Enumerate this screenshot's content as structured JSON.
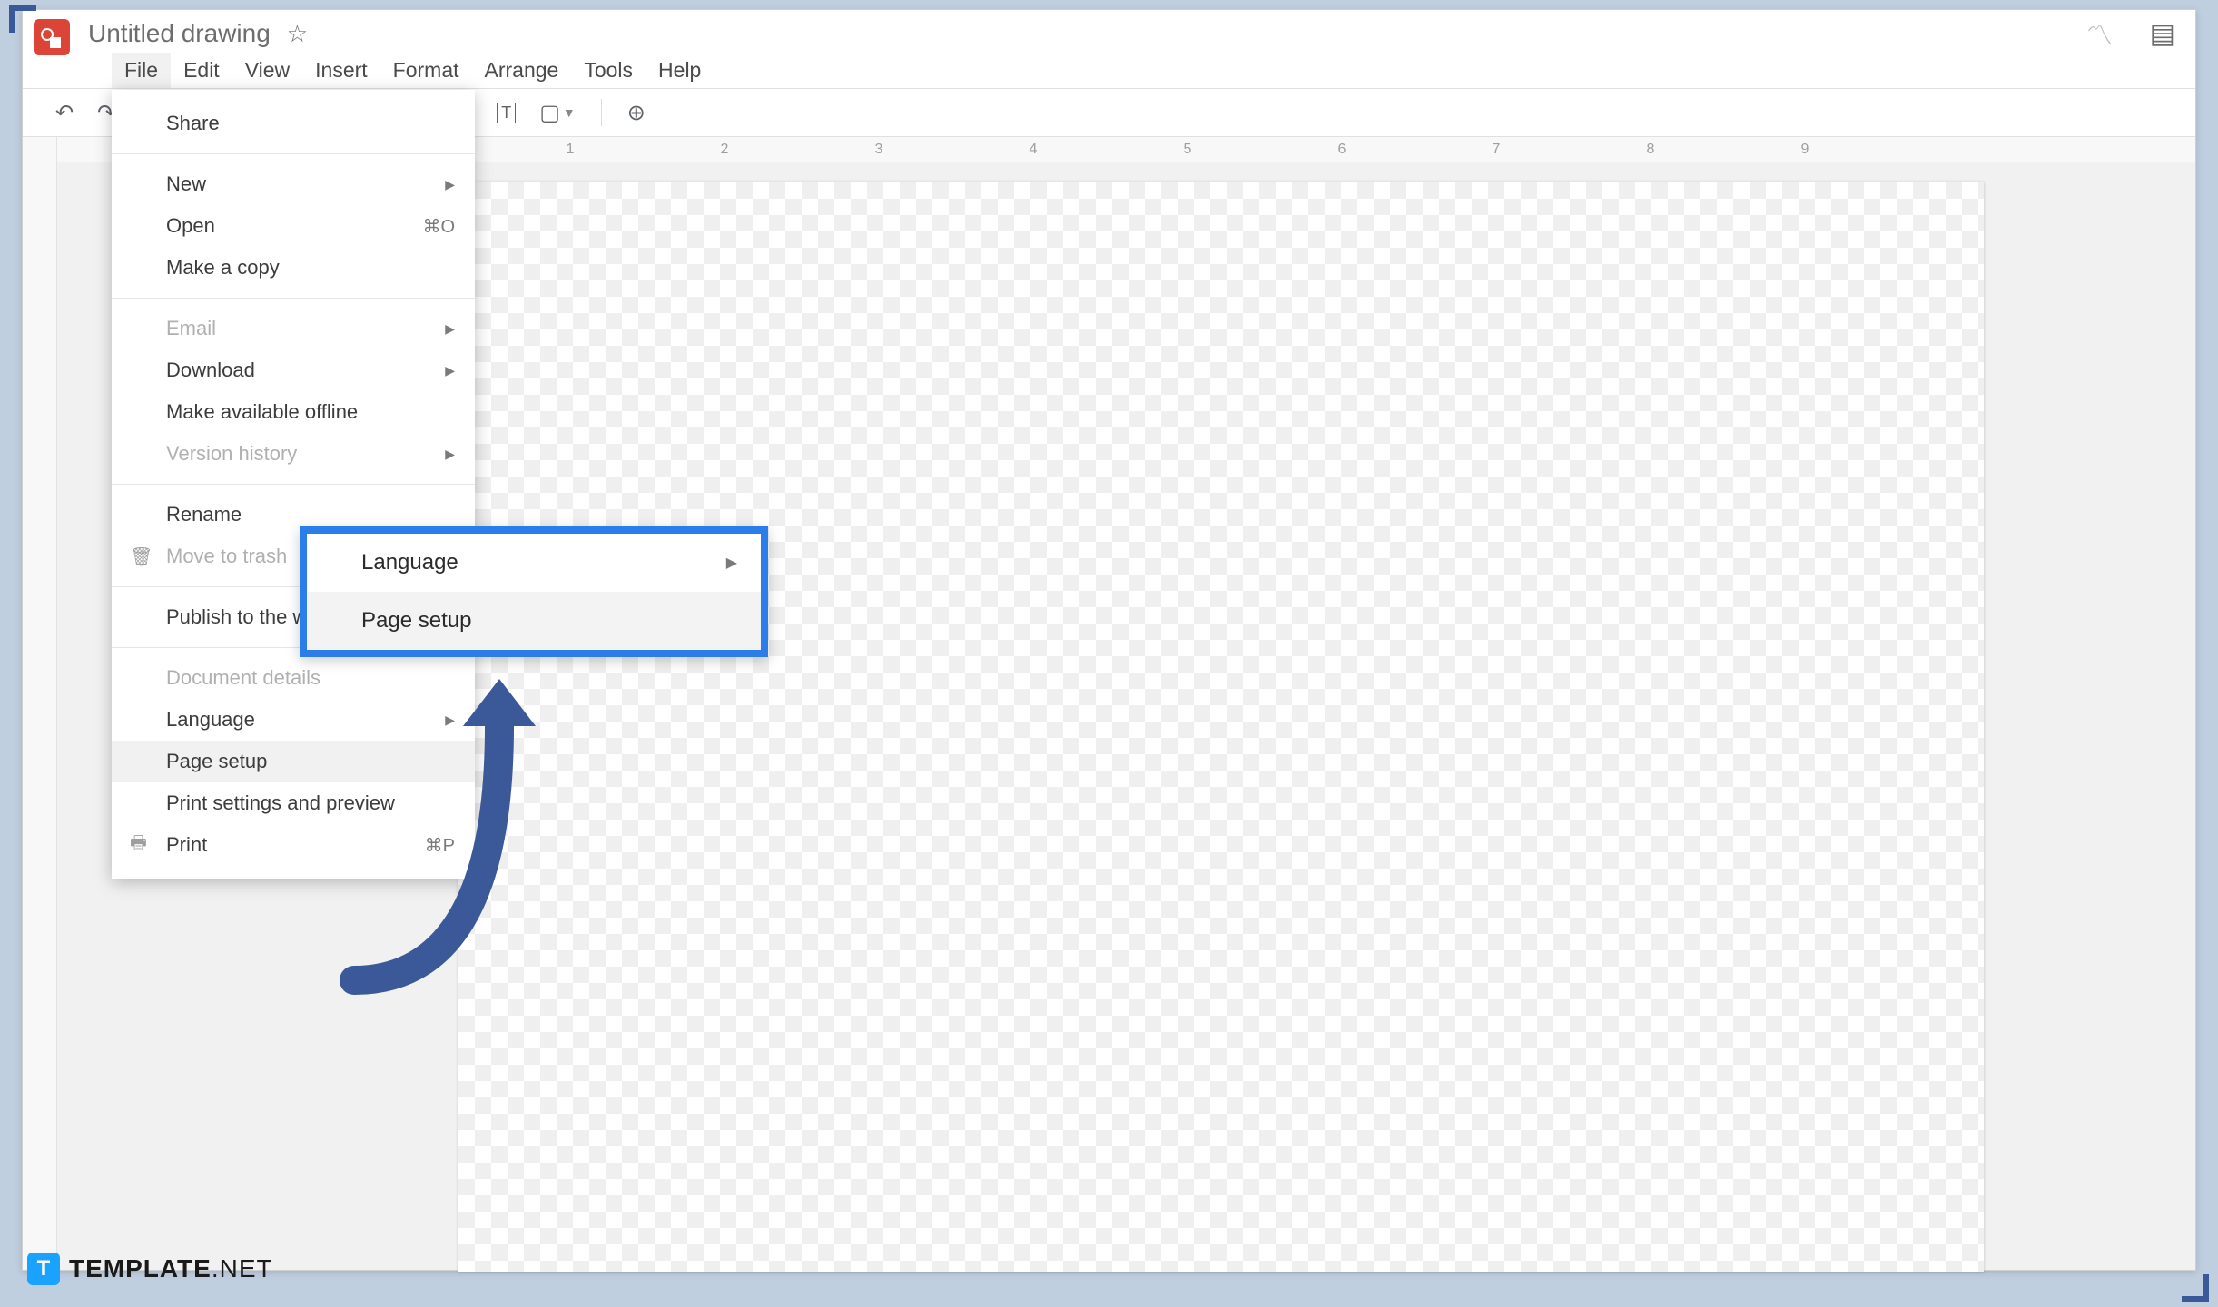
{
  "header": {
    "doc_title": "Untitled drawing",
    "star_glyph": "☆",
    "trend_glyph": "〽",
    "comment_glyph": "▤"
  },
  "menubar": {
    "items": [
      "File",
      "Edit",
      "View",
      "Insert",
      "Format",
      "Arrange",
      "Tools",
      "Help"
    ],
    "active_index": 0
  },
  "toolbar": {
    "undo": "↶",
    "redo": "↷",
    "textbox": "T",
    "image": "▢",
    "more": "⊕"
  },
  "ruler": {
    "marks": [
      "1",
      "2",
      "3",
      "4",
      "5",
      "6",
      "7",
      "8",
      "9"
    ]
  },
  "file_menu": {
    "share": "Share",
    "new": "New",
    "open": {
      "label": "Open",
      "shortcut": "⌘O"
    },
    "make_copy": "Make a copy",
    "email": "Email",
    "download": "Download",
    "make_offline": "Make available offline",
    "version_history": "Version history",
    "rename": "Rename",
    "move_trash": "Move to trash",
    "publish": "Publish to the web",
    "doc_details": "Document details",
    "language": "Language",
    "page_setup": "Page setup",
    "print_preview": "Print settings and preview",
    "print": {
      "label": "Print",
      "shortcut": "⌘P"
    }
  },
  "callout": {
    "language": "Language",
    "page_setup": "Page setup"
  },
  "watermark": {
    "badge": "T",
    "brand_bold": "TEMPLATE",
    "brand_thin": ".NET"
  }
}
